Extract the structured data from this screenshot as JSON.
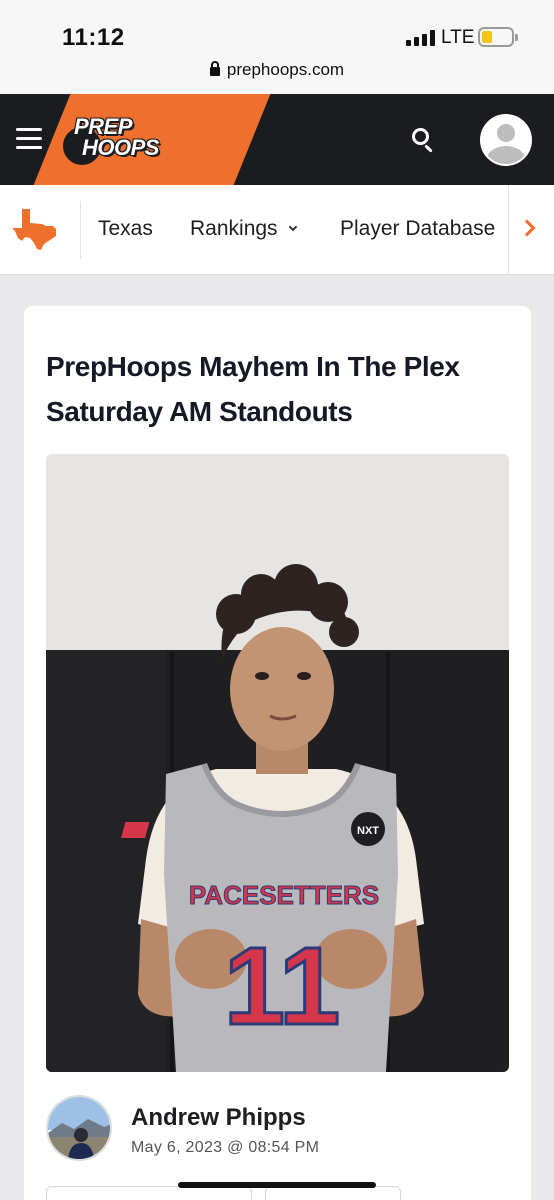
{
  "status_bar": {
    "time": "11:12",
    "network": "LTE"
  },
  "browser": {
    "url": "prephoops.com"
  },
  "header": {
    "logo_line1": "PREP",
    "logo_line2": "HOOPS",
    "brand_color": "#ef6f2c",
    "icons": [
      "hamburger-icon",
      "search-icon",
      "profile-icon"
    ]
  },
  "subnav": {
    "items": [
      {
        "label": "Texas"
      },
      {
        "label": "Rankings"
      },
      {
        "label": "Player Database"
      }
    ]
  },
  "article": {
    "title": "PrepHoops Mayhem In The Plex Saturday AM Standouts",
    "jersey_text": "PACESETTERS",
    "jersey_number": "11",
    "jersey_badge": "NXT",
    "author": "Andrew Phipps",
    "date": "May 6, 2023 @ 08:54 PM"
  }
}
